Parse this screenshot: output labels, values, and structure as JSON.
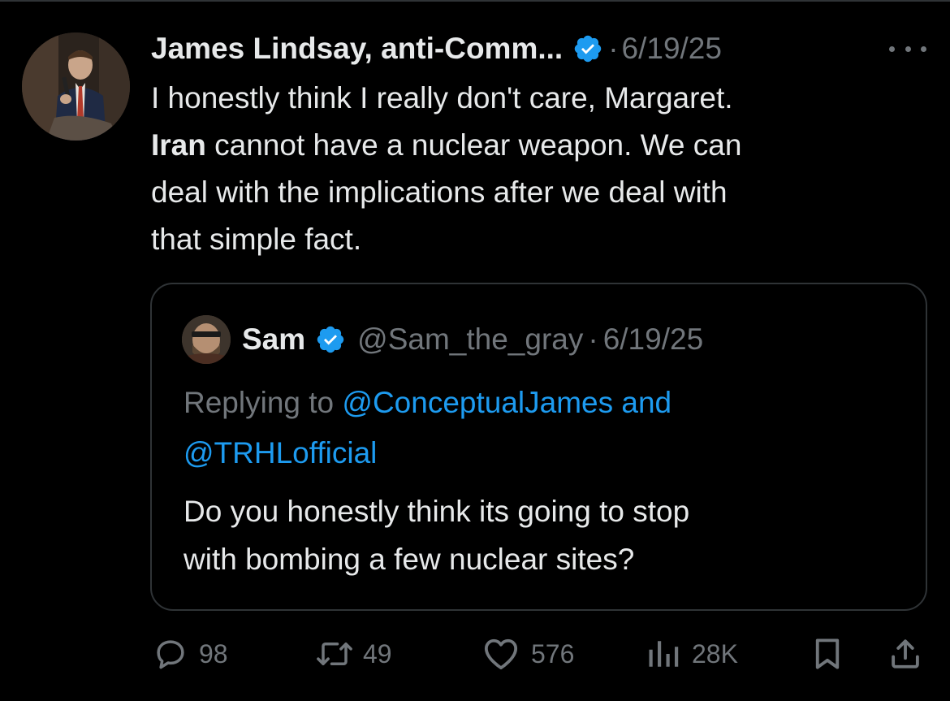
{
  "tweet": {
    "author_name": "James Lindsay, anti-Comm...",
    "separator": "·",
    "date": "6/19/25",
    "text_line1": "I honestly think I really don't care, Margaret.",
    "text_bold": "Iran",
    "text_line2_rest": " cannot have a nuclear weapon. We can",
    "text_line3": "deal with the implications after we deal with",
    "text_line4": "that simple fact."
  },
  "quote": {
    "name": "Sam",
    "handle": "@Sam_the_gray",
    "separator": "·",
    "date": "6/19/25",
    "replying_prefix": "Replying to ",
    "mention1": "@ConceptualJames",
    "mention_join": " and",
    "mention2": "@TRHLofficial",
    "text_line1": "Do you honestly think its going to stop",
    "text_line2": "with bombing a few nuclear sites?"
  },
  "actions": {
    "replies": "98",
    "reposts": "49",
    "likes": "576",
    "views": "28K"
  },
  "colors": {
    "background": "#000000",
    "text": "#e7e9ea",
    "secondary": "#71767b",
    "accent": "#1d9bf0",
    "border": "#2f3336"
  },
  "icons": [
    "verified-badge-icon",
    "more-icon",
    "reply-icon",
    "repost-icon",
    "like-icon",
    "views-icon",
    "bookmark-icon",
    "share-icon"
  ]
}
